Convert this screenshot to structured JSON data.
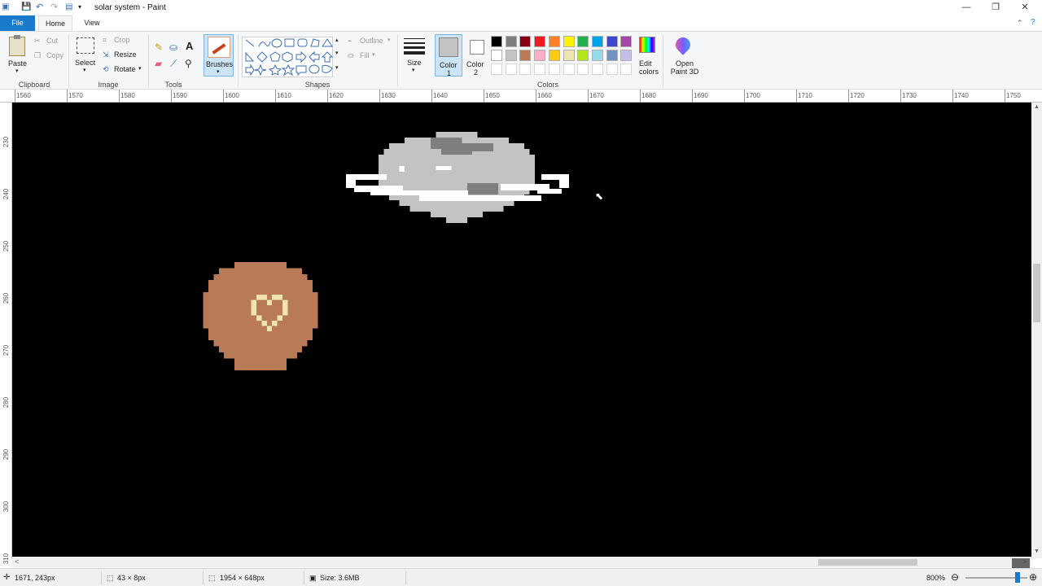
{
  "window": {
    "title": "solar system - Paint",
    "minimize": "—",
    "restore": "❐",
    "close": "✕"
  },
  "tabs": {
    "file": "File",
    "home": "Home",
    "view": "View"
  },
  "clipboard": {
    "paste": "Paste",
    "cut": "Cut",
    "copy": "Copy",
    "group": "Clipboard"
  },
  "image": {
    "select": "Select",
    "crop": "Crop",
    "resize": "Resize",
    "rotate": "Rotate",
    "group": "Image"
  },
  "tools": {
    "group": "Tools",
    "text_icon": "A"
  },
  "brushes": {
    "label": "Brushes"
  },
  "shapes": {
    "outline": "Outline",
    "fill": "Fill",
    "group": "Shapes"
  },
  "size": {
    "label": "Size"
  },
  "colors": {
    "color1": "Color",
    "color1_num": "1",
    "color2": "Color",
    "color2_num": "2",
    "color1_value": "#c3c3c3",
    "color2_value": "#ffffff",
    "edit": "Edit colors",
    "group": "Colors",
    "palette_row1": [
      "#000000",
      "#7f7f7f",
      "#880015",
      "#ed1c24",
      "#ff7f27",
      "#fff200",
      "#22b14c",
      "#00a2e8",
      "#3f48cc",
      "#a349a4"
    ],
    "palette_row2": [
      "#ffffff",
      "#c3c3c3",
      "#b97a57",
      "#ffaec9",
      "#ffc90e",
      "#efe4b0",
      "#b5e61d",
      "#99d9ea",
      "#7092be",
      "#c8bfe7"
    ]
  },
  "paint3d": {
    "label": "Open Paint 3D"
  },
  "ruler_h": [
    "1560",
    "1570",
    "1580",
    "1590",
    "1600",
    "1610",
    "1620",
    "1630",
    "1640",
    "1650",
    "1660",
    "1670",
    "1680",
    "1690",
    "1700",
    "1710",
    "1720",
    "1730",
    "1740",
    "1750"
  ],
  "ruler_v": [
    "230",
    "240",
    "250",
    "260",
    "270",
    "280",
    "290",
    "300",
    "310"
  ],
  "status": {
    "cursor": "1671, 243px",
    "selection": "43 × 8px",
    "image_size": "1954 × 648px",
    "file_size": "Size: 3.6MB",
    "zoom": "800%"
  },
  "scene": {
    "saturn_color": "#c3c3c3",
    "saturn_dark": "#7f7f7f",
    "ring_color": "#ffffff",
    "planet_color": "#b97a57",
    "heart_color": "#efe4b0"
  }
}
